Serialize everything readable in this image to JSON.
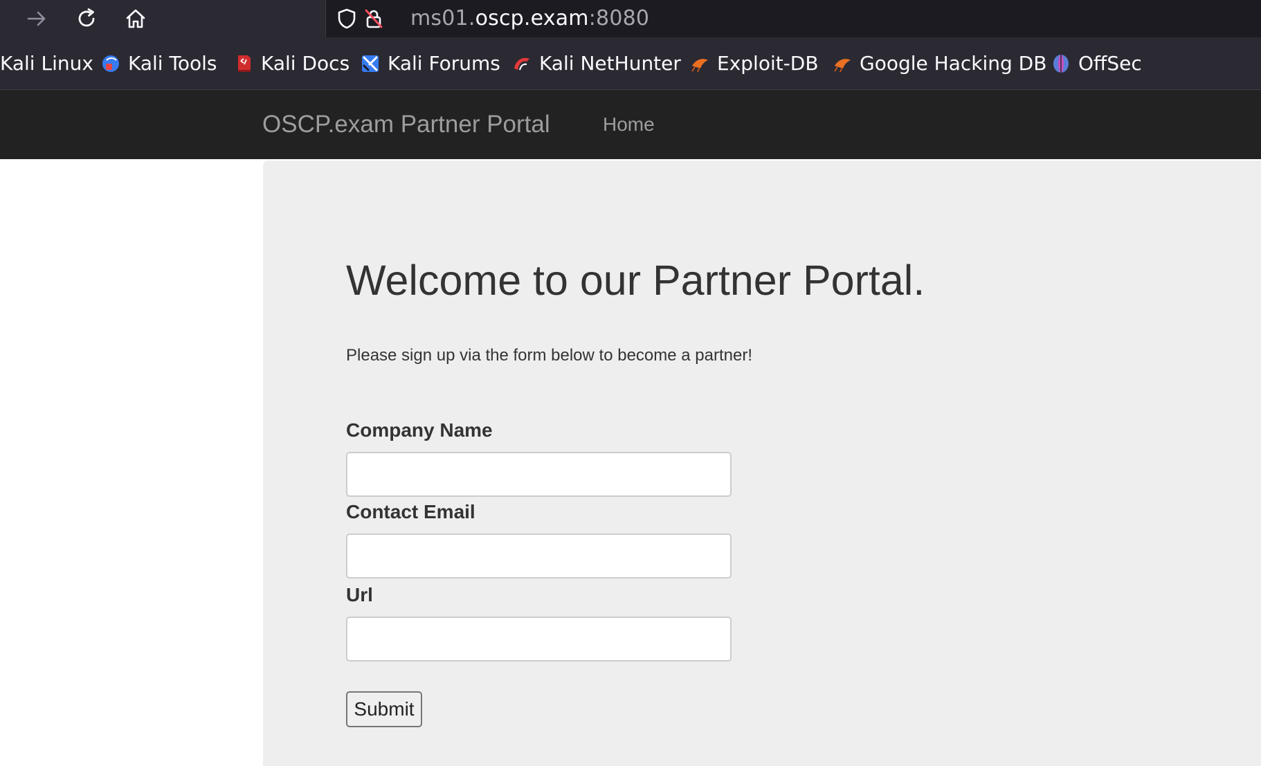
{
  "browser": {
    "url": {
      "subdomain": "ms01.",
      "host": "oscp.exam",
      "port": ":8080"
    },
    "nav_icons": [
      "forward-arrow-icon",
      "reload-icon",
      "home-icon"
    ],
    "url_icons": [
      "shield-icon",
      "insecure-lock-icon"
    ],
    "bookmarks": [
      {
        "label": "Kali Linux",
        "icon": "none"
      },
      {
        "label": "Kali Tools",
        "icon": "kali-tools-icon"
      },
      {
        "label": "Kali Docs",
        "icon": "kali-docs-icon"
      },
      {
        "label": "Kali Forums",
        "icon": "kali-forums-icon"
      },
      {
        "label": "Kali NetHunter",
        "icon": "kali-nethunter-icon"
      },
      {
        "label": "Exploit-DB",
        "icon": "exploit-db-icon"
      },
      {
        "label": "Google Hacking DB",
        "icon": "exploit-db-icon"
      },
      {
        "label": "OffSec",
        "icon": "offsec-icon"
      }
    ]
  },
  "site": {
    "brand": "OSCP.exam Partner Portal",
    "nav_home": "Home"
  },
  "main": {
    "heading": "Welcome to our Partner Portal.",
    "lead": "Please sign up via the form below to become a partner!",
    "form": {
      "company_label": "Company Name",
      "company_value": "",
      "email_label": "Contact Email",
      "email_value": "",
      "url_label": "Url",
      "url_value": "",
      "submit_label": "Submit"
    }
  },
  "colors": {
    "browser_chrome": "#2b2a33",
    "urlbar": "#1c1b22",
    "navbar": "#222222",
    "jumbotron": "#eeeeee",
    "brand_text": "#9d9d9d",
    "body_text": "#333333"
  }
}
